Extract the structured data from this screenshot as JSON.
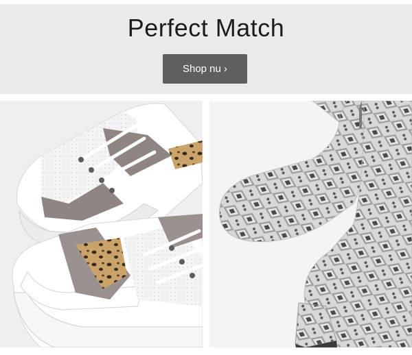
{
  "banner": {
    "title": "Perfect Match",
    "button_label": "Shop nu ›"
  },
  "products": [
    {
      "name": "sneakers-image",
      "description_icon": "leopard-sneakers"
    },
    {
      "name": "boots-image",
      "description_icon": "snake-ankle-boots"
    }
  ],
  "colors": {
    "banner_bg": "#ebebeb",
    "button_bg": "#5f5f5f",
    "button_text": "#ffffff",
    "title_text": "#1c1c1c"
  }
}
